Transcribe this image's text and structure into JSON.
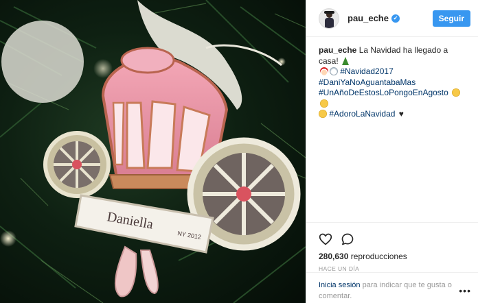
{
  "post": {
    "username": "pau_eche",
    "verified_mark": "✔",
    "follow_label": "Seguir",
    "caption": {
      "user": "pau_eche",
      "text": "La Navidad ha llegado a casa!",
      "hashtags": [
        "#Navidad2017",
        "#DaniYaNoAguantabaMas",
        "#UnAñoDeEstosLoPongoEnAgosto",
        "#AdoroLaNavidad"
      ]
    },
    "ornament_name": "Daniella",
    "ornament_stamp": "NY 2012",
    "views_count": "280,630",
    "views_label": "reproducciones",
    "timestamp": "HACE UN DÍA",
    "login_link": "Inicia sesión",
    "login_text": "para indicar que te gusta o comentar.",
    "more_options": "•••"
  },
  "icons": {
    "like": "heart-outline-icon",
    "comment": "speech-bubble-icon",
    "verified": "verified-badge-icon",
    "more": "more-options-icon"
  },
  "colors": {
    "follow_button": "#3897f0",
    "verified": "#3897f0",
    "hashtag": "#003569",
    "muted": "#999999"
  }
}
